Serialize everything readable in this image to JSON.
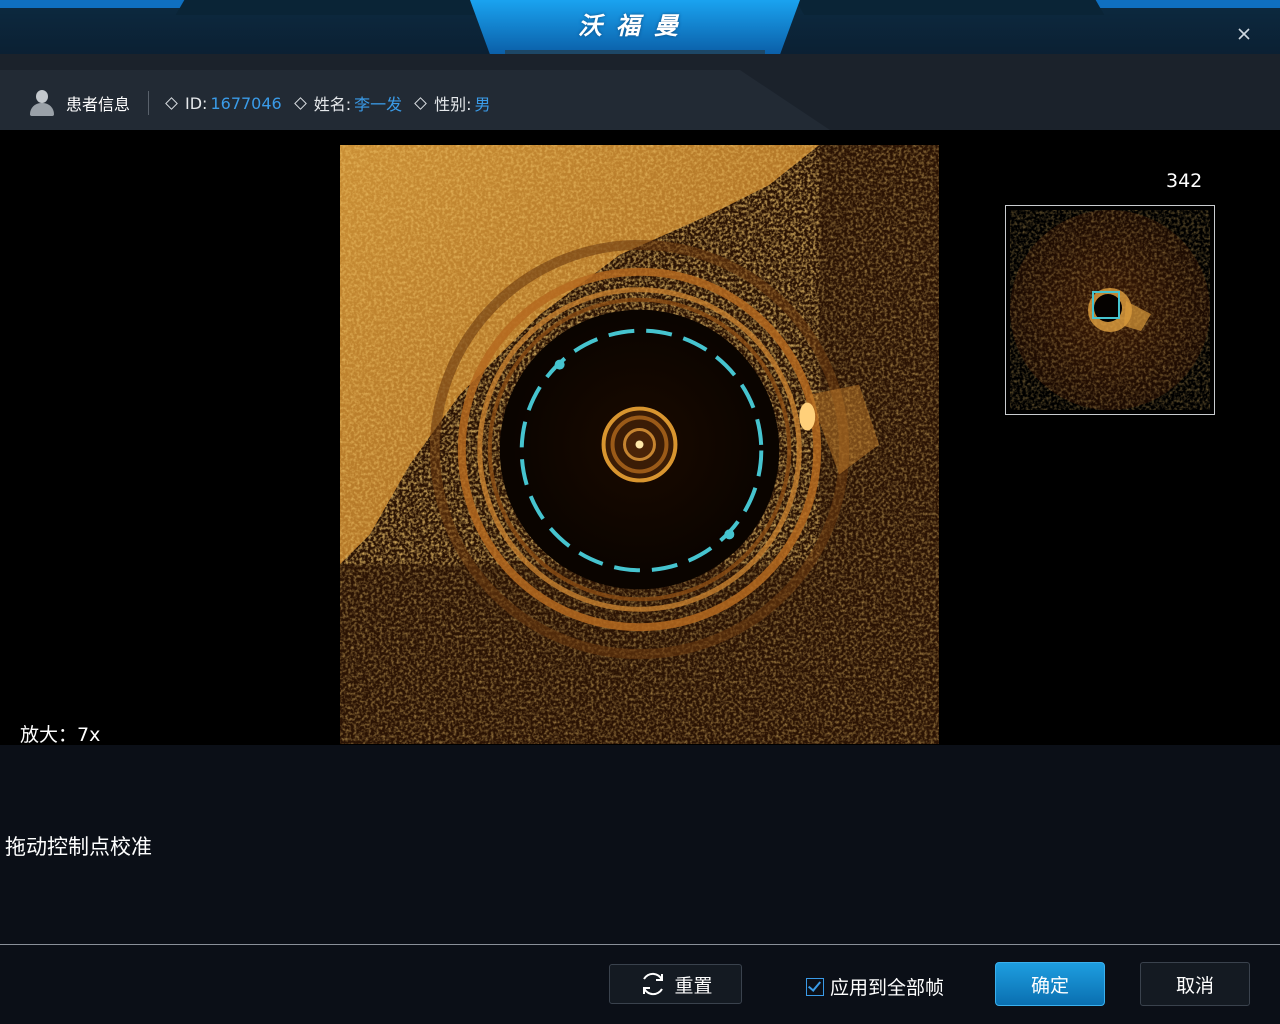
{
  "app_title": "沃福曼",
  "patient": {
    "section_label": "患者信息",
    "id_label": "ID:",
    "id_value": "1677046",
    "name_label": "姓名:",
    "name_value": "李一发",
    "gender_label": "性别:",
    "gender_value": "男"
  },
  "viewer": {
    "frame_number": "342",
    "zoom_text": "放大：7x"
  },
  "instruction": "拖动控制点校准",
  "footer": {
    "reset_label": "重置",
    "apply_all_label": "应用到全部帧",
    "apply_all_checked": true,
    "confirm_label": "确定",
    "cancel_label": "取消"
  },
  "colors": {
    "accent": "#1e9ee0",
    "value_text": "#3a9be8",
    "calibration_circle": "#46c4cf",
    "oct_gold": "#e3a33a"
  }
}
